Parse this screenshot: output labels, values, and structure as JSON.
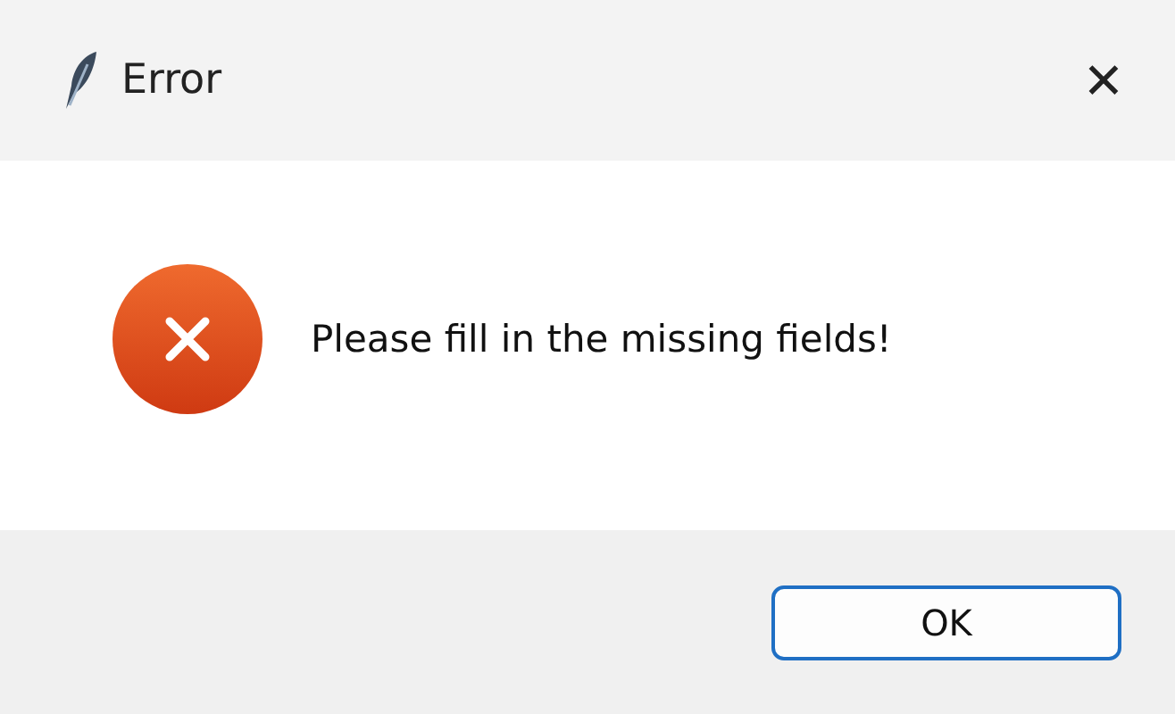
{
  "window": {
    "title": "Error",
    "close": "✕"
  },
  "message": {
    "text": "Please fill in the missing fields!"
  },
  "buttons": [
    {
      "label": "OK",
      "selected": true
    }
  ]
}
